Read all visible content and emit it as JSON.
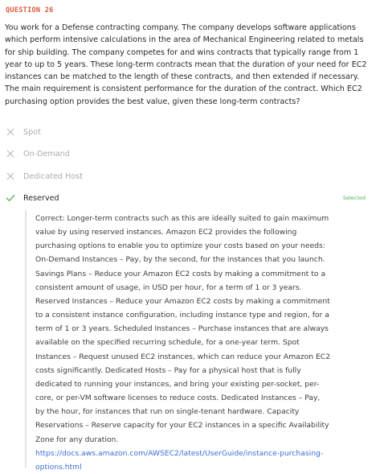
{
  "question": {
    "number_label": "QUESTION 26",
    "text": "You work for a Defense contracting company. The company develops software applications which perform intensive calculations in the area of Mechanical Engineering related to metals for ship building. The company competes for and wins contracts that typically range from 1 year to up to 5 years. These long-term contracts mean that the duration of your need for EC2 instances can be matched to the length of these contracts, and then extended if necessary. The main requirement is consistent performance for the duration of the contract. Which EC2 purchasing option provides the best value, given these long-term contracts?"
  },
  "options": [
    {
      "label": "Spot",
      "state": "wrong",
      "icon": "x-icon"
    },
    {
      "label": "On-Demand",
      "state": "wrong",
      "icon": "x-icon"
    },
    {
      "label": "Dedicated Host",
      "state": "wrong",
      "icon": "x-icon"
    },
    {
      "label": "Reserved",
      "state": "correct",
      "icon": "check-icon",
      "badge": "Selected"
    }
  ],
  "explanation": {
    "text": "Correct: Longer-term contracts such as this are ideally suited to gain maximum value by using reserved instances. Amazon EC2 provides the following purchasing options to enable you to optimize your costs based on your needs: On-Demand Instances – Pay, by the second, for the instances that you launch. Savings Plans – Reduce your Amazon EC2 costs by making a commitment to a consistent amount of usage, in USD per hour, for a term of 1 or 3 years. Reserved Instances – Reduce your Amazon EC2 costs by making a commitment to a consistent instance configuration, including instance type and region, for a term of 1 or 3 years. Scheduled Instances – Purchase instances that are always available on the specified recurring schedule, for a one-year term. Spot Instances – Request unused EC2 instances, which can reduce your Amazon EC2 costs significantly. Dedicated Hosts – Pay for a physical host that is fully dedicated to running your instances, and bring your existing per-socket, per-core, or per-VM software licenses to reduce costs. Dedicated Instances – Pay, by the hour, for instances that run on single-tenant hardware. Capacity Reservations – Reserve capacity for your EC2 instances in a specific Availability Zone for any duration.",
    "link": "https://docs.aws.amazon.com/AWSEC2/latest/UserGuide/instance-purchasing-options.html"
  },
  "colors": {
    "question_number": "#d9573e",
    "wrong_icon": "#b8bbc1",
    "correct_icon": "#4fae5c",
    "badge": "#4fae5c",
    "link": "#3a6fd6"
  }
}
